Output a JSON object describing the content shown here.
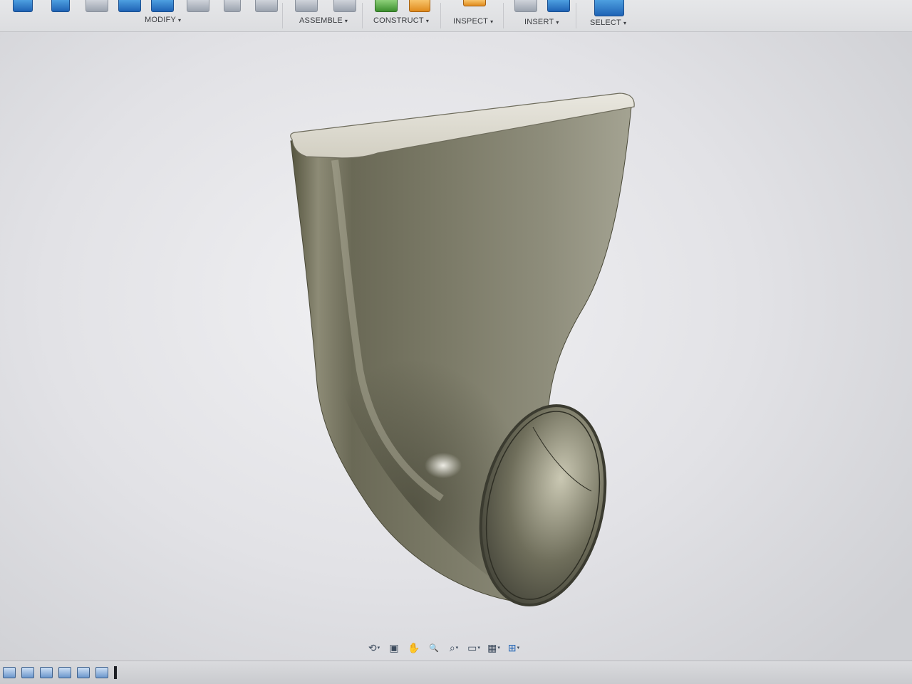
{
  "toolbar": {
    "menus": [
      {
        "label": "MODIFY"
      },
      {
        "label": "ASSEMBLE"
      },
      {
        "label": "CONSTRUCT"
      },
      {
        "label": "INSPECT"
      },
      {
        "label": "INSERT"
      },
      {
        "label": "SELECT"
      }
    ],
    "caret": "▾"
  },
  "model": {
    "description_icon": "3d-body",
    "color": "#8a8874"
  },
  "navbar": {
    "items": [
      {
        "icon": "orbit-icon",
        "glyph": "⟲",
        "dropdown": true
      },
      {
        "icon": "look-at-icon",
        "glyph": "▣",
        "dropdown": false
      },
      {
        "icon": "pan-icon",
        "glyph": "✋",
        "dropdown": false
      },
      {
        "icon": "zoom-icon",
        "glyph": "🔍",
        "dropdown": false
      },
      {
        "icon": "fit-icon",
        "glyph": "⌕",
        "dropdown": true
      },
      {
        "icon": "display-settings-icon",
        "glyph": "▭",
        "dropdown": true
      },
      {
        "icon": "grid-settings-icon",
        "glyph": "▦",
        "dropdown": true
      },
      {
        "icon": "viewports-icon",
        "glyph": "⊞",
        "dropdown": true
      }
    ]
  },
  "timeline": {
    "items": [
      "sketch-feature-icon",
      "extrude-feature-icon",
      "body-feature-icon",
      "loft-feature-icon",
      "sweep-feature-icon",
      "shell-feature-icon"
    ]
  }
}
